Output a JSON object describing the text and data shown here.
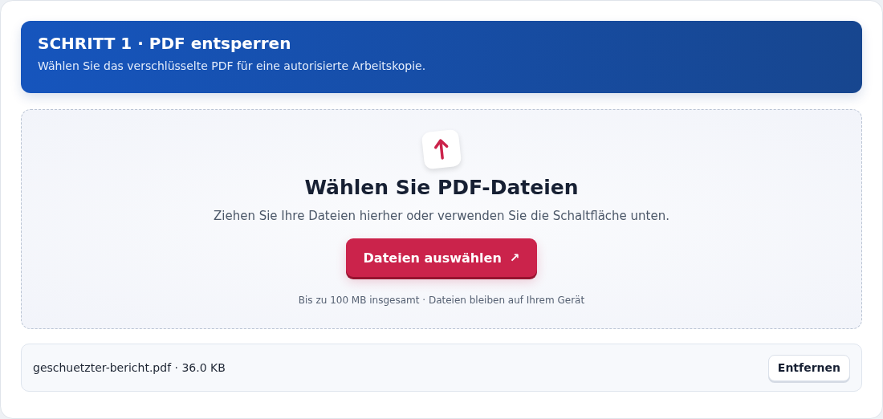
{
  "header": {
    "title": "SCHRITT 1 · PDF entsperren",
    "subtitle": "Wählen Sie das verschlüsselte PDF für eine autorisierte Arbeitskopie."
  },
  "dropzone": {
    "title": "Wählen Sie PDF-Dateien",
    "hint": "Ziehen Sie Ihre Dateien hierher oder verwenden Sie die Schaltfläche unten.",
    "button": {
      "label": "Dateien auswählen",
      "glyph": "↗"
    },
    "note": "Bis zu 100 MB insgesamt · Dateien bleiben auf Ihrem Gerät"
  },
  "files": [
    {
      "name": "geschuetzter-bericht.pdf · 36.0 KB",
      "action": "Entfernen"
    }
  ]
}
